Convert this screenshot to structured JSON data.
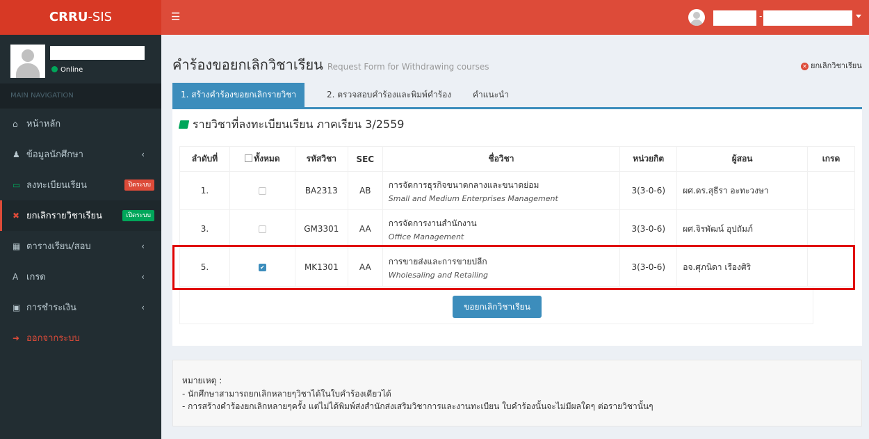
{
  "app": {
    "logo_bold": "CRRU",
    "logo_rest": "-SIS",
    "menu_icon": "hamburger-icon"
  },
  "topbar": {
    "user_separator": "-"
  },
  "sidebar": {
    "status": "Online",
    "nav_header": "MAIN NAVIGATION",
    "items": [
      {
        "label": "หน้าหลัก",
        "icon": "home-icon",
        "glyph": "⌂"
      },
      {
        "label": "ข้อมูลนักศึกษา",
        "icon": "user-icon",
        "glyph": "♟"
      },
      {
        "label": "ลงทะเบียนเรียน",
        "icon": "desktop-icon",
        "glyph": "▭",
        "badge": "ปิดระบบ"
      },
      {
        "label": "ยกเลิกรายวิชาเรียน",
        "icon": "times-circle-icon",
        "glyph": "✖",
        "badge": "เปิดระบบ"
      },
      {
        "label": "ตารางเรียน/สอบ",
        "icon": "calendar-icon",
        "glyph": "▦"
      },
      {
        "label": "เกรด",
        "icon": "font-icon",
        "glyph": "A"
      },
      {
        "label": "การชำระเงิน",
        "icon": "money-icon",
        "glyph": "▣"
      },
      {
        "label": "ออกจากระบบ",
        "icon": "sign-out-icon",
        "glyph": "➜"
      }
    ]
  },
  "header": {
    "title": "คำร้องขอยกเลิกวิชาเรียน",
    "subtitle": "Request Form for Withdrawing courses",
    "link": "ยกเลิกวิชาเรียน"
  },
  "tabs": [
    "1. สร้างคำร้องขอยกเลิกรายวิชา",
    "2. ตรวจสอบคำร้องและพิมพ์คำร้อง",
    "คำแนะนำ"
  ],
  "section": {
    "title": "รายวิชาที่ลงทะเบียนเรียน ภาคเรียน 3/2559"
  },
  "table": {
    "headers": {
      "no": "ลำดับที่",
      "all": "ทั้งหมด",
      "code": "รหัสวิชา",
      "sec": "SEC",
      "name": "ชื่อวิชา",
      "credit": "หน่วยกิต",
      "teacher": "ผู้สอน",
      "grade": "เกรด"
    },
    "rows": [
      {
        "no": "1.",
        "checked": false,
        "code": "BA2313",
        "sec": "AB",
        "name_th": "การจัดการธุรกิจขนาดกลางและขนาดย่อม",
        "name_en": "Small and Medium Enterprises Management",
        "credit": "3(3-0-6)",
        "teacher": "ผศ.ดร.สุธีรา อะทะวงษา",
        "grade": ""
      },
      {
        "no": "3.",
        "checked": false,
        "code": "GM3301",
        "sec": "AA",
        "name_th": "การจัดการงานสำนักงาน",
        "name_en": "Office Management",
        "credit": "3(3-0-6)",
        "teacher": "ผศ.จิรพัฒน์ อุปถัมภ์",
        "grade": ""
      },
      {
        "no": "5.",
        "checked": true,
        "code": "MK1301",
        "sec": "AA",
        "name_th": "การขายส่งและการขายปลีก",
        "name_en": "Wholesaling and Retailing",
        "credit": "3(3-0-6)",
        "teacher": "อจ.ศุภนิดา เรืองศิริ",
        "grade": ""
      }
    ]
  },
  "button": {
    "label": "ขอยกเลิกวิชาเรียน"
  },
  "note": {
    "title": "หมายเหตุ :",
    "lines": [
      "- นักศึกษาสามารถยกเลิกหลายๆวิชาได้ในใบคำร้องเดียวได้",
      "- การสร้างคำร้องยกเลิกหลายๆครั้ง แต่ไม่ได้พิมพ์ส่งสำนักส่งเสริมวิชาการและงานทะเบียน ใบคำร้องนั้นจะไม่มีผลใดๆ ต่อรายวิชานั้นๆ"
    ]
  },
  "colors": {
    "brand": "#dd4b39",
    "sidebar": "#222d32",
    "primary": "#3c8dbc",
    "success": "#00a65a",
    "highlight": "#e00000"
  }
}
